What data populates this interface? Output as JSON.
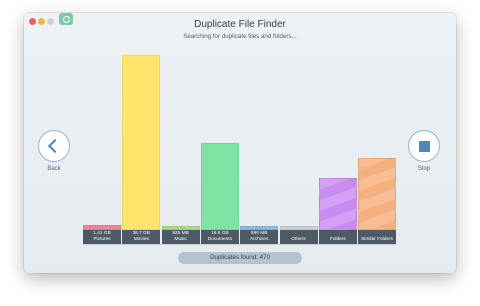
{
  "window": {
    "title": "Duplicate File Finder",
    "subtitle": "Searching for duplicate files and folders..."
  },
  "nav": {
    "back_label": "Back",
    "stop_label": "Stop"
  },
  "footer": {
    "prefix": "Duplicates found:",
    "count": "470"
  },
  "chart_data": {
    "type": "bar",
    "value_scale": "relative fill level, 0-1, read from bar heights",
    "categories": [
      {
        "key": "pictures",
        "size": "1.41 GB",
        "label": "Pictures",
        "level": 0.03,
        "color": "#e8869b"
      },
      {
        "key": "movies",
        "size": "36.7 GB",
        "label": "Movies",
        "level": 1.0,
        "color": "#fde46a"
      },
      {
        "key": "music",
        "size": "925 MB",
        "label": "Music",
        "level": 0.015,
        "color": "#a7d989"
      },
      {
        "key": "documents",
        "size": "18.5 GB",
        "label": "Documents",
        "level": 0.5,
        "color": "#7fe3a4"
      },
      {
        "key": "archives",
        "size": "590 MB",
        "label": "Archives",
        "level": 0.012,
        "color": "#8fb8d9"
      },
      {
        "key": "others",
        "size": "",
        "label": "Others",
        "level": 0.0,
        "color": "#c9cfd6"
      },
      {
        "key": "folders",
        "size": "",
        "label": "Folders",
        "level": 0.3,
        "color": "#c98bf0"
      },
      {
        "key": "similar_folders",
        "size": "",
        "label": "Similar Folders",
        "level": 0.41,
        "color": "#f5b07e"
      }
    ]
  }
}
